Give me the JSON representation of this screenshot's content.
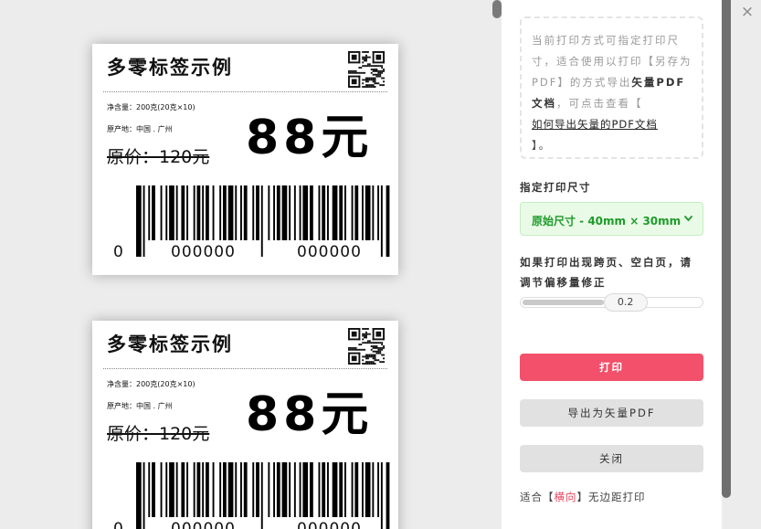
{
  "preview": {
    "labels": [
      {
        "title": "多零标签示例",
        "net_content": "净含量：200克(20克×10)",
        "origin": "原产地：中国 . 广州",
        "original_price": "原价：120元",
        "price": "88元",
        "barcode_digits": [
          "0",
          "000000",
          "000000"
        ]
      },
      {
        "title": "多零标签示例",
        "net_content": "净含量：200克(20克×10)",
        "origin": "原产地：中国 . 广州",
        "original_price": "原价：120元",
        "price": "88元",
        "barcode_digits": [
          "0",
          "000000",
          "000000"
        ]
      }
    ]
  },
  "panel": {
    "note": {
      "text1": "当前打印方式可指定打印尺寸，适合使用以打印【另存为PDF】的方式导出",
      "bold": "矢量PDF文档",
      "text2": "，可点击查看【",
      "link": "如何导出矢量的PDF文档",
      "text3": "】。"
    },
    "size_title": "指定打印尺寸",
    "size_select": "原始尺寸 - 40mm × 30mm",
    "offset_title": "如果打印出现跨页、空白页，请调节偏移量修正",
    "offset_value": "0.2",
    "offset_fraction": 0.45,
    "print_button": "打印",
    "export_button": "导出为矢量PDF",
    "close_button": "关闭",
    "fit": {
      "pre": "适合【",
      "accent": "横向",
      "post": "】无边距打印"
    }
  },
  "window": {
    "close_label": "×"
  },
  "colors": {
    "accent": "#f2506b",
    "select_bg": "#e9fbe7",
    "select_text": "#1e9a2a",
    "preview_bg": "#ececec"
  },
  "icons": [
    "qr-code-icon",
    "chevron-down-icon",
    "close-icon"
  ]
}
